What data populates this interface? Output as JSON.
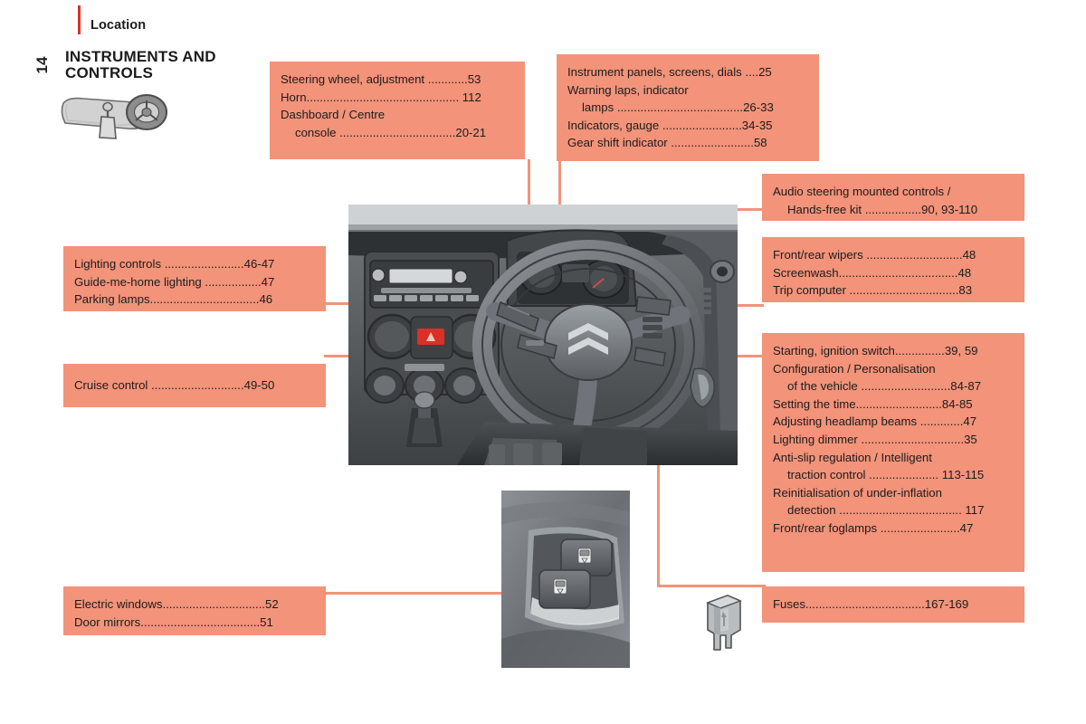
{
  "header": {
    "kicker": "Location",
    "page_number": "14",
    "section_title": "INSTRUMENTS AND CONTROLS",
    "icon": "dashboard-steering-wheel-icon",
    "accent_color": "#d8342a"
  },
  "theme": {
    "callout_bg": "#f2937a",
    "text_color": "#1c1c1c",
    "page_bg": "#ffffff"
  },
  "callouts": [
    {
      "id": "steering-wheel",
      "lines": [
        {
          "text": "Steering wheel, adjustment ............53",
          "indent": false
        },
        {
          "text": "Horn.............................................. 112",
          "indent": false
        },
        {
          "text": "Dashboard / Centre",
          "indent": false
        },
        {
          "text": "console ...................................20-21",
          "indent": true
        }
      ]
    },
    {
      "id": "instrument-panels",
      "lines": [
        {
          "text": "Instrument panels, screens, dials ....25",
          "indent": false
        },
        {
          "text": "Warning laps, indicator",
          "indent": false
        },
        {
          "text": "lamps ......................................26-33",
          "indent": true
        },
        {
          "text": "Indicators, gauge ........................34-35",
          "indent": false
        },
        {
          "text": "Gear shift indicator .........................58",
          "indent": false
        }
      ]
    },
    {
      "id": "audio-steering-controls",
      "lines": [
        {
          "text": "Audio steering mounted controls /",
          "indent": false
        },
        {
          "text": "Hands-free kit .................90, 93-110",
          "indent": true
        }
      ]
    },
    {
      "id": "wipers-screenwash",
      "lines": [
        {
          "text": "Front/rear wipers .............................48",
          "indent": false
        },
        {
          "text": "Screenwash....................................48",
          "indent": false
        },
        {
          "text": "Trip computer .................................83",
          "indent": false
        }
      ]
    },
    {
      "id": "lighting-controls",
      "lines": [
        {
          "text": "Lighting controls ........................46-47",
          "indent": false
        },
        {
          "text": "Guide-me-home lighting .................47",
          "indent": false
        },
        {
          "text": "Parking lamps.................................46",
          "indent": false
        }
      ]
    },
    {
      "id": "cruise-control",
      "lines": [
        {
          "text": "Cruise control ............................49-50",
          "indent": false
        }
      ]
    },
    {
      "id": "starting-configuration",
      "lines": [
        {
          "text": "Starting, ignition switch...............39, 59",
          "indent": false
        },
        {
          "text": "Configuration / Personalisation",
          "indent": false
        },
        {
          "text": "of the vehicle ...........................84-87",
          "indent": true
        },
        {
          "text": "Setting the time..........................84-85",
          "indent": false
        },
        {
          "text": "Adjusting headlamp beams .............47",
          "indent": false
        },
        {
          "text": "Lighting dimmer ...............................35",
          "indent": false
        },
        {
          "text": "Anti-slip regulation / Intelligent",
          "indent": false
        },
        {
          "text": "traction control ..................... 113-115",
          "indent": true
        },
        {
          "text": "Reinitialisation of under-inflation",
          "indent": false
        },
        {
          "text": "detection ..................................... 117",
          "indent": true
        },
        {
          "text": "Front/rear foglamps ........................47",
          "indent": false
        }
      ]
    },
    {
      "id": "electric-windows",
      "lines": [
        {
          "text": "Electric windows...............................52",
          "indent": false
        },
        {
          "text": "Door mirrors....................................51",
          "indent": false
        }
      ]
    },
    {
      "id": "fuses",
      "lines": [
        {
          "text": "Fuses....................................167-169",
          "indent": false
        }
      ]
    }
  ],
  "photos": [
    {
      "id": "dashboard-photo",
      "alt": "Right-hand-drive dashboard with steering wheel, instrument cluster, radio and centre console"
    },
    {
      "id": "window-switch-photo",
      "alt": "Door panel electric window switches"
    },
    {
      "id": "fuse-icon",
      "alt": "Blade fuse"
    }
  ]
}
